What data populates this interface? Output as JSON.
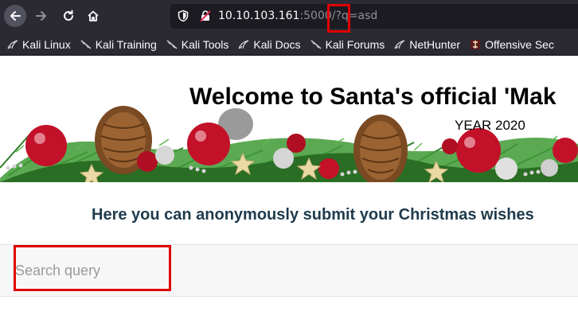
{
  "browser": {
    "url": {
      "host": "10.10.103.161",
      "rest": ":5000/?q=asd"
    },
    "bookmarks": [
      {
        "label": "Kali Linux",
        "icon": "kali-dragon-icon"
      },
      {
        "label": "Kali Training",
        "icon": "kali-dragon-icon"
      },
      {
        "label": "Kali Tools",
        "icon": "kali-dragon-icon"
      },
      {
        "label": "Kali Docs",
        "icon": "kali-dragon-icon"
      },
      {
        "label": "Kali Forums",
        "icon": "kali-dragon-icon"
      },
      {
        "label": "NetHunter",
        "icon": "kali-dragon-icon"
      },
      {
        "label": "Offensive Sec",
        "icon": "offsec-icon"
      }
    ]
  },
  "page": {
    "title": "Welcome to Santa's official 'Mak",
    "year": "YEAR 2020",
    "subtitle": "Here you can anonymously submit your Christmas wishes",
    "search": {
      "placeholder": "Search query",
      "value": ""
    }
  },
  "colors": {
    "toolbar": "#2b2a33",
    "urlbar": "#1c1b22",
    "highlight": "#e00000",
    "subtitle": "#1f3b4d"
  }
}
